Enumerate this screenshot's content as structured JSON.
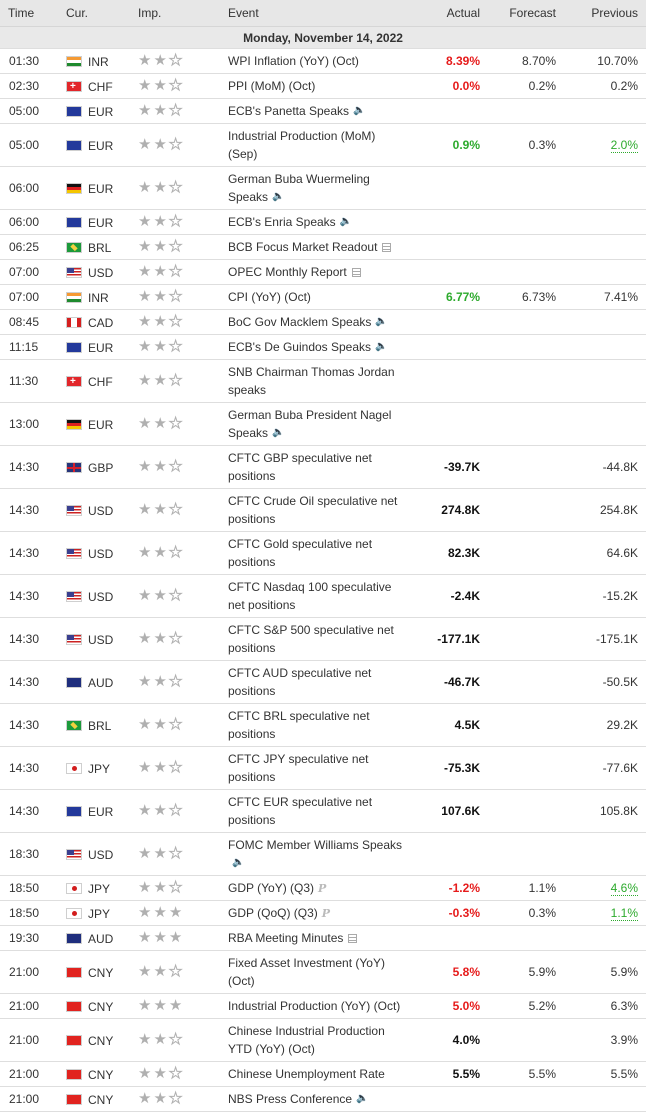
{
  "headers": {
    "time": "Time",
    "cur": "Cur.",
    "imp": "Imp.",
    "event": "Event",
    "actual": "Actual",
    "forecast": "Forecast",
    "previous": "Previous"
  },
  "date_label": "Monday, November 14, 2022",
  "rows": [
    {
      "time": "01:30",
      "flag": "inr",
      "cur": "INR",
      "stars": 2,
      "event": "WPI Inflation (YoY) (Oct)",
      "icon": "",
      "actual": "8.39%",
      "actual_color": "red",
      "forecast": "8.70%",
      "previous": "10.70%",
      "prev_color": ""
    },
    {
      "time": "02:30",
      "flag": "chf",
      "cur": "CHF",
      "stars": 2,
      "event": "PPI (MoM) (Oct)",
      "icon": "",
      "actual": "0.0%",
      "actual_color": "red",
      "forecast": "0.2%",
      "previous": "0.2%",
      "prev_color": ""
    },
    {
      "time": "05:00",
      "flag": "eur",
      "cur": "EUR",
      "stars": 2,
      "event": "ECB's Panetta Speaks",
      "icon": "speaker-icon",
      "actual": "",
      "actual_color": "",
      "forecast": "",
      "previous": "",
      "prev_color": ""
    },
    {
      "time": "05:00",
      "flag": "eur",
      "cur": "EUR",
      "stars": 2,
      "event": "Industrial Production (MoM) (Sep)",
      "icon": "",
      "actual": "0.9%",
      "actual_color": "green",
      "forecast": "0.3%",
      "previous": "2.0%",
      "prev_color": "green"
    },
    {
      "time": "06:00",
      "flag": "deu",
      "cur": "EUR",
      "stars": 2,
      "event": "German Buba Wuermeling Speaks",
      "icon": "speaker-icon",
      "actual": "",
      "actual_color": "",
      "forecast": "",
      "previous": "",
      "prev_color": ""
    },
    {
      "time": "06:00",
      "flag": "eur",
      "cur": "EUR",
      "stars": 2,
      "event": "ECB's Enria Speaks",
      "icon": "speaker-icon",
      "actual": "",
      "actual_color": "",
      "forecast": "",
      "previous": "",
      "prev_color": ""
    },
    {
      "time": "06:25",
      "flag": "brl",
      "cur": "BRL",
      "stars": 2,
      "event": "BCB Focus Market Readout",
      "icon": "report-icon",
      "actual": "",
      "actual_color": "",
      "forecast": "",
      "previous": "",
      "prev_color": ""
    },
    {
      "time": "07:00",
      "flag": "usd",
      "cur": "USD",
      "stars": 2,
      "event": "OPEC Monthly Report",
      "icon": "report-icon",
      "actual": "",
      "actual_color": "",
      "forecast": "",
      "previous": "",
      "prev_color": ""
    },
    {
      "time": "07:00",
      "flag": "inr",
      "cur": "INR",
      "stars": 2,
      "event": "CPI (YoY) (Oct)",
      "icon": "",
      "actual": "6.77%",
      "actual_color": "green",
      "forecast": "6.73%",
      "previous": "7.41%",
      "prev_color": ""
    },
    {
      "time": "08:45",
      "flag": "cad",
      "cur": "CAD",
      "stars": 2,
      "event": "BoC Gov Macklem Speaks",
      "icon": "speaker-icon",
      "actual": "",
      "actual_color": "",
      "forecast": "",
      "previous": "",
      "prev_color": ""
    },
    {
      "time": "11:15",
      "flag": "eur",
      "cur": "EUR",
      "stars": 2,
      "event": "ECB's De Guindos Speaks",
      "icon": "speaker-icon",
      "actual": "",
      "actual_color": "",
      "forecast": "",
      "previous": "",
      "prev_color": ""
    },
    {
      "time": "11:30",
      "flag": "chf",
      "cur": "CHF",
      "stars": 2,
      "event": "SNB Chairman Thomas Jordan speaks",
      "icon": "",
      "actual": "",
      "actual_color": "",
      "forecast": "",
      "previous": "",
      "prev_color": ""
    },
    {
      "time": "13:00",
      "flag": "deu",
      "cur": "EUR",
      "stars": 2,
      "event": "German Buba President Nagel Speaks",
      "icon": "speaker-icon",
      "actual": "",
      "actual_color": "",
      "forecast": "",
      "previous": "",
      "prev_color": ""
    },
    {
      "time": "14:30",
      "flag": "gbp",
      "cur": "GBP",
      "stars": 2,
      "event": "CFTC GBP speculative net positions",
      "icon": "",
      "actual": "-39.7K",
      "actual_color": "black",
      "forecast": "",
      "previous": "-44.8K",
      "prev_color": ""
    },
    {
      "time": "14:30",
      "flag": "usd",
      "cur": "USD",
      "stars": 2,
      "event": "CFTC Crude Oil speculative net positions",
      "icon": "",
      "actual": "274.8K",
      "actual_color": "black",
      "forecast": "",
      "previous": "254.8K",
      "prev_color": ""
    },
    {
      "time": "14:30",
      "flag": "usd",
      "cur": "USD",
      "stars": 2,
      "event": "CFTC Gold speculative net positions",
      "icon": "",
      "actual": "82.3K",
      "actual_color": "black",
      "forecast": "",
      "previous": "64.6K",
      "prev_color": ""
    },
    {
      "time": "14:30",
      "flag": "usd",
      "cur": "USD",
      "stars": 2,
      "event": "CFTC Nasdaq 100 speculative net positions",
      "icon": "",
      "actual": "-2.4K",
      "actual_color": "black",
      "forecast": "",
      "previous": "-15.2K",
      "prev_color": ""
    },
    {
      "time": "14:30",
      "flag": "usd",
      "cur": "USD",
      "stars": 2,
      "event": "CFTC S&P 500 speculative net positions",
      "icon": "",
      "actual": "-177.1K",
      "actual_color": "black",
      "forecast": "",
      "previous": "-175.1K",
      "prev_color": ""
    },
    {
      "time": "14:30",
      "flag": "aud",
      "cur": "AUD",
      "stars": 2,
      "event": "CFTC AUD speculative net positions",
      "icon": "",
      "actual": "-46.7K",
      "actual_color": "black",
      "forecast": "",
      "previous": "-50.5K",
      "prev_color": ""
    },
    {
      "time": "14:30",
      "flag": "brl",
      "cur": "BRL",
      "stars": 2,
      "event": "CFTC BRL speculative net positions",
      "icon": "",
      "actual": "4.5K",
      "actual_color": "black",
      "forecast": "",
      "previous": "29.2K",
      "prev_color": ""
    },
    {
      "time": "14:30",
      "flag": "jpy",
      "cur": "JPY",
      "stars": 2,
      "event": "CFTC JPY speculative net positions",
      "icon": "",
      "actual": "-75.3K",
      "actual_color": "black",
      "forecast": "",
      "previous": "-77.6K",
      "prev_color": ""
    },
    {
      "time": "14:30",
      "flag": "eur",
      "cur": "EUR",
      "stars": 2,
      "event": "CFTC EUR speculative net positions",
      "icon": "",
      "actual": "107.6K",
      "actual_color": "black",
      "forecast": "",
      "previous": "105.8K",
      "prev_color": ""
    },
    {
      "time": "18:30",
      "flag": "usd",
      "cur": "USD",
      "stars": 2,
      "event": "FOMC Member Williams Speaks",
      "icon": "speaker-icon",
      "actual": "",
      "actual_color": "",
      "forecast": "",
      "previous": "",
      "prev_color": ""
    },
    {
      "time": "18:50",
      "flag": "jpy",
      "cur": "JPY",
      "stars": 2,
      "event": "GDP (YoY) (Q3)",
      "icon": "preliminary-icon",
      "actual": "-1.2%",
      "actual_color": "red",
      "forecast": "1.1%",
      "previous": "4.6%",
      "prev_color": "green"
    },
    {
      "time": "18:50",
      "flag": "jpy",
      "cur": "JPY",
      "stars": 3,
      "event": "GDP (QoQ) (Q3)",
      "icon": "preliminary-icon",
      "actual": "-0.3%",
      "actual_color": "red",
      "forecast": "0.3%",
      "previous": "1.1%",
      "prev_color": "green"
    },
    {
      "time": "19:30",
      "flag": "aud",
      "cur": "AUD",
      "stars": 3,
      "event": "RBA Meeting Minutes",
      "icon": "report-icon",
      "actual": "",
      "actual_color": "",
      "forecast": "",
      "previous": "",
      "prev_color": ""
    },
    {
      "time": "21:00",
      "flag": "cny",
      "cur": "CNY",
      "stars": 2,
      "event": "Fixed Asset Investment (YoY) (Oct)",
      "icon": "",
      "actual": "5.8%",
      "actual_color": "red",
      "forecast": "5.9%",
      "previous": "5.9%",
      "prev_color": ""
    },
    {
      "time": "21:00",
      "flag": "cny",
      "cur": "CNY",
      "stars": 3,
      "event": "Industrial Production (YoY) (Oct)",
      "icon": "",
      "actual": "5.0%",
      "actual_color": "red",
      "forecast": "5.2%",
      "previous": "6.3%",
      "prev_color": ""
    },
    {
      "time": "21:00",
      "flag": "cny",
      "cur": "CNY",
      "stars": 2,
      "event": "Chinese Industrial Production YTD (YoY) (Oct)",
      "icon": "",
      "actual": "4.0%",
      "actual_color": "black",
      "forecast": "",
      "previous": "3.9%",
      "prev_color": ""
    },
    {
      "time": "21:00",
      "flag": "cny",
      "cur": "CNY",
      "stars": 2,
      "event": "Chinese Unemployment Rate",
      "icon": "",
      "actual": "5.5%",
      "actual_color": "black",
      "forecast": "5.5%",
      "previous": "5.5%",
      "prev_color": ""
    },
    {
      "time": "21:00",
      "flag": "cny",
      "cur": "CNY",
      "stars": 2,
      "event": "NBS Press Conference",
      "icon": "speaker-icon",
      "actual": "",
      "actual_color": "",
      "forecast": "",
      "previous": "",
      "prev_color": ""
    }
  ]
}
